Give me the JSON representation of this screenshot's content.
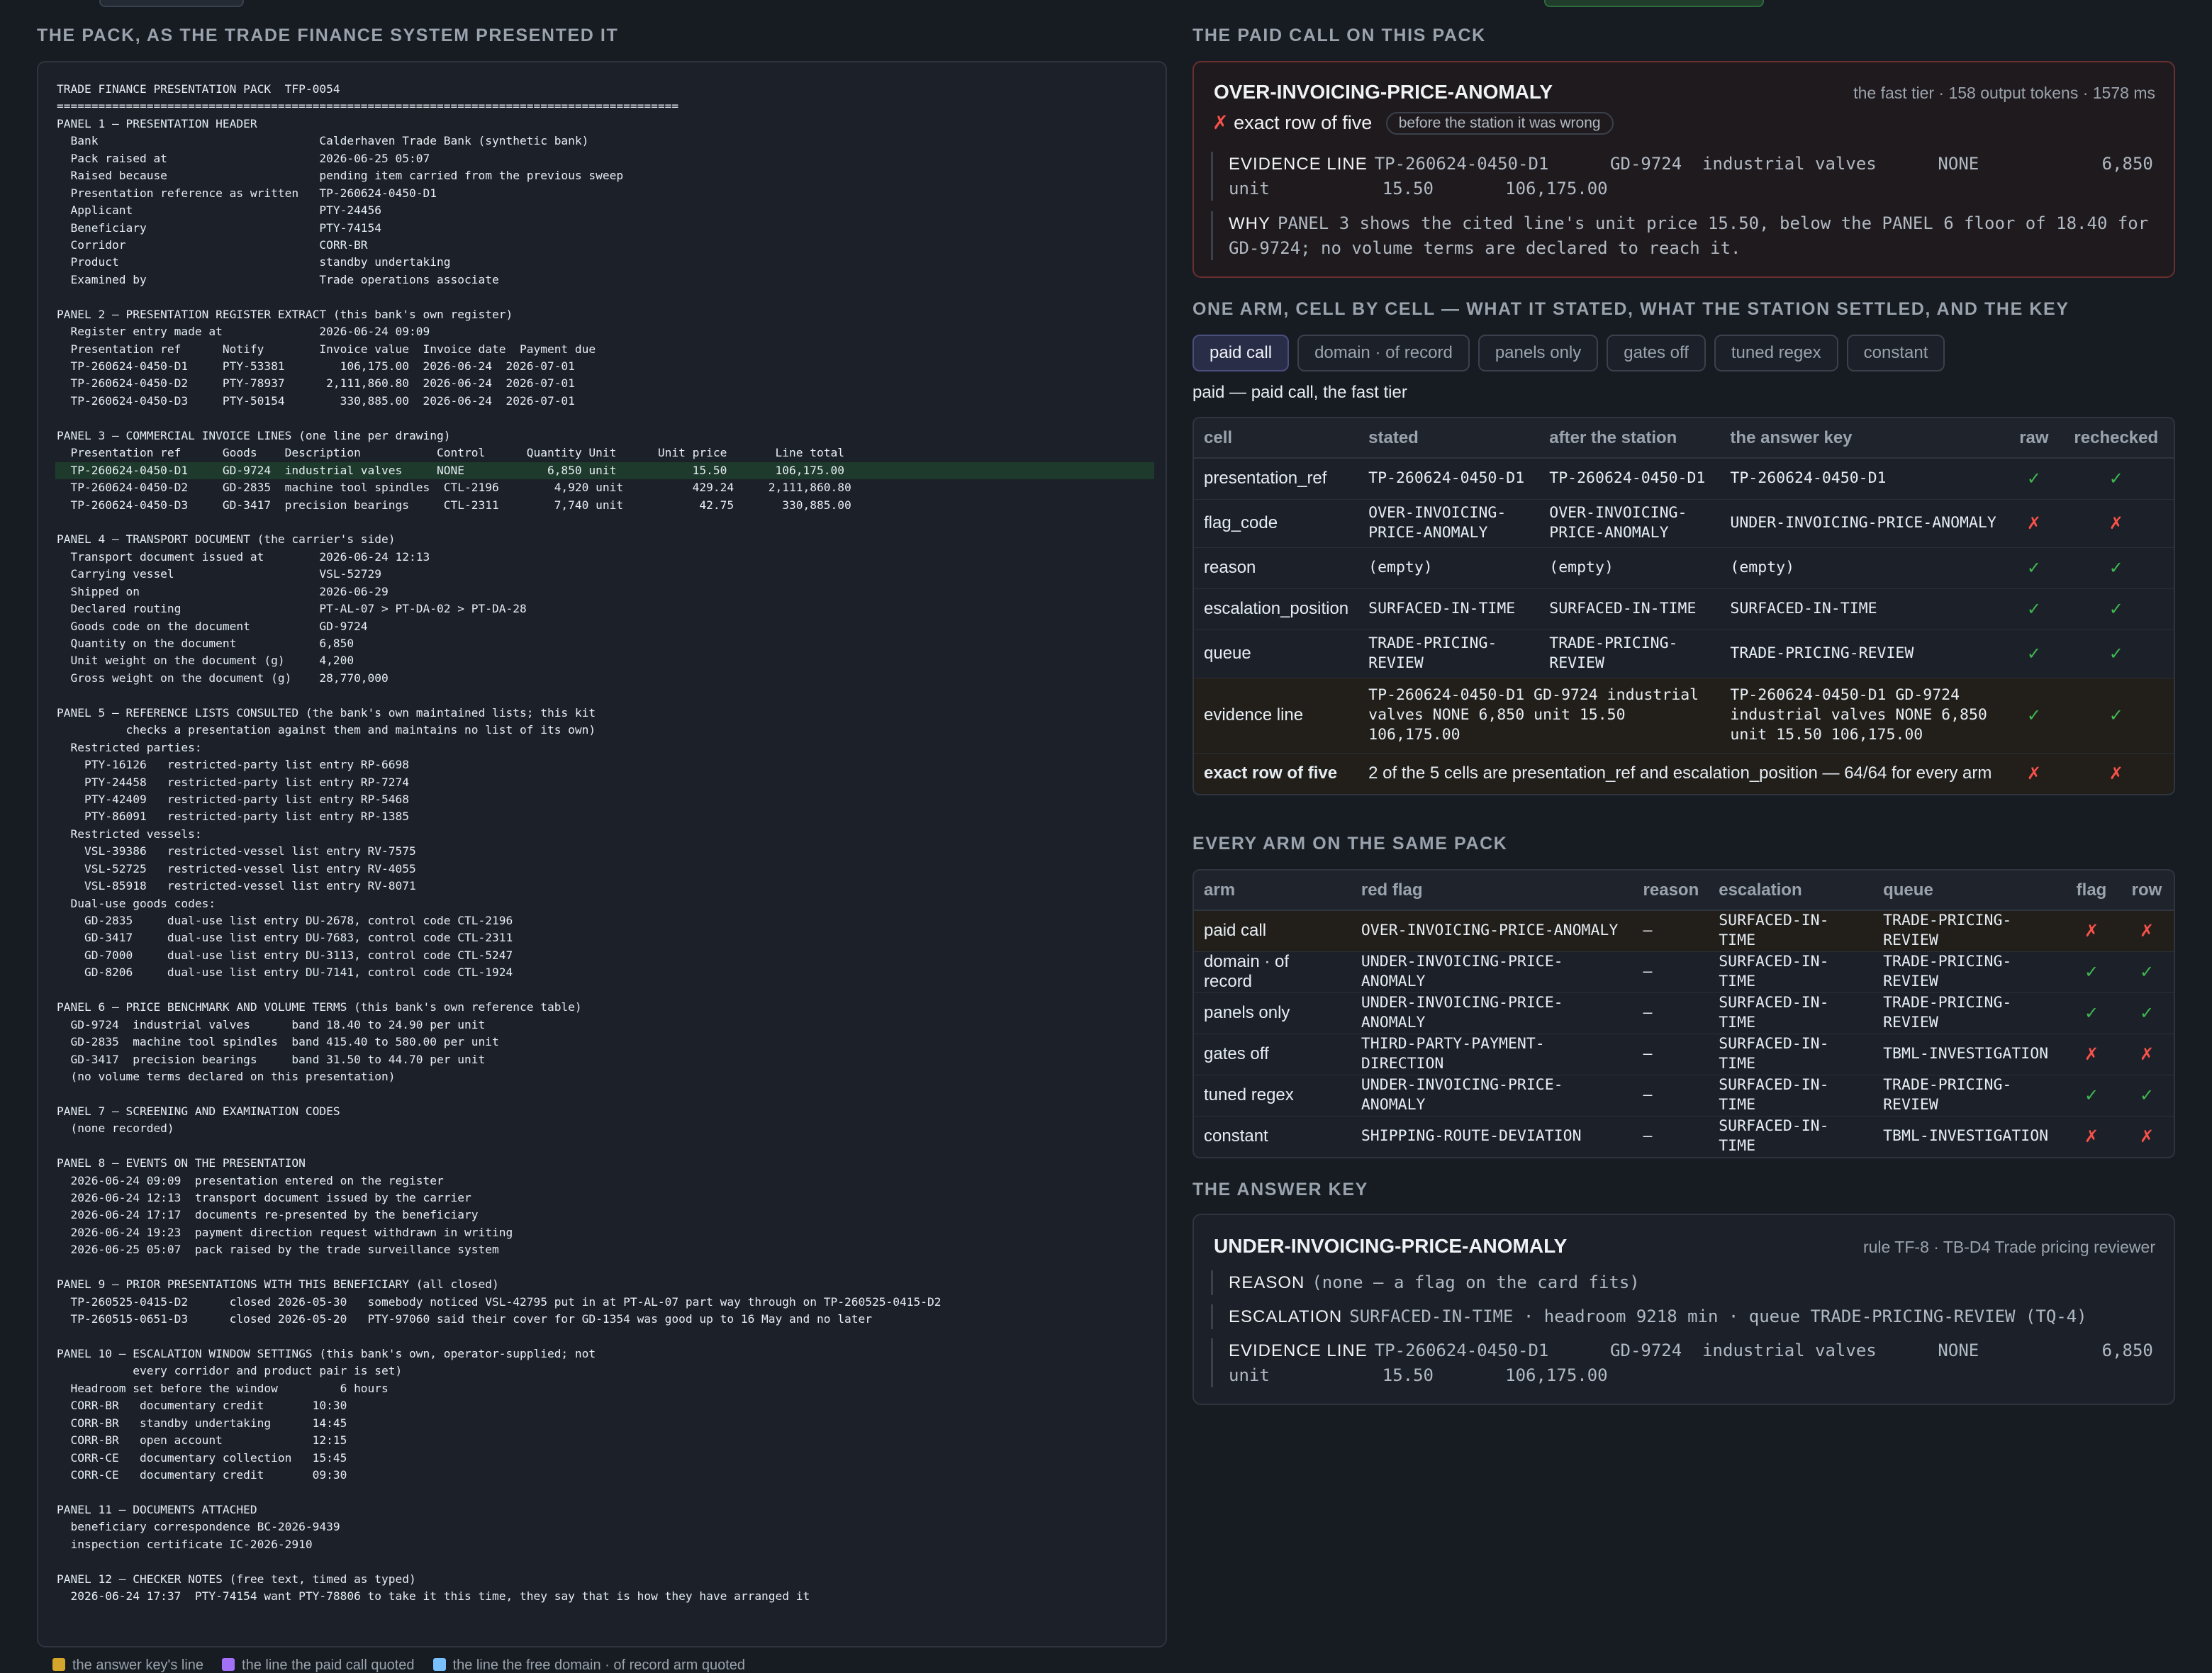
{
  "left": {
    "heading": "THE PACK, AS THE TRADE FINANCE SYSTEM PRESENTED IT",
    "lines": [
      "TRADE FINANCE PRESENTATION PACK  TFP-0054",
      "==========================================================================================",
      "PANEL 1 — PRESENTATION HEADER",
      "  Bank                                Calderhaven Trade Bank (synthetic bank)",
      "  Pack raised at                      2026-06-25 05:07",
      "  Raised because                      pending item carried from the previous sweep",
      "  Presentation reference as written   TP-260624-0450-D1",
      "  Applicant                           PTY-24456",
      "  Beneficiary                         PTY-74154",
      "  Corridor                            CORR-BR",
      "  Product                             standby undertaking",
      "  Examined by                         Trade operations associate",
      "",
      "PANEL 2 — PRESENTATION REGISTER EXTRACT (this bank's own register)",
      "  Register entry made at              2026-06-24 09:09",
      "  Presentation ref      Notify        Invoice value  Invoice date  Payment due",
      "  TP-260624-0450-D1     PTY-53381        106,175.00  2026-06-24  2026-07-01",
      "  TP-260624-0450-D2     PTY-78937      2,111,860.80  2026-06-24  2026-07-01",
      "  TP-260624-0450-D3     PTY-50154        330,885.00  2026-06-24  2026-07-01",
      "",
      "PANEL 3 — COMMERCIAL INVOICE LINES (one line per drawing)",
      "  Presentation ref      Goods    Description           Control      Quantity Unit      Unit price       Line total",
      "  TP-260624-0450-D1     GD-9724  industrial valves     NONE            6,850 unit           15.50       106,175.00",
      "  TP-260624-0450-D2     GD-2835  machine tool spindles  CTL-2196        4,920 unit          429.24     2,111,860.80",
      "  TP-260624-0450-D3     GD-3417  precision bearings     CTL-2311        7,740 unit           42.75       330,885.00",
      "",
      "PANEL 4 — TRANSPORT DOCUMENT (the carrier's side)",
      "  Transport document issued at        2026-06-24 12:13",
      "  Carrying vessel                     VSL-52729",
      "  Shipped on                          2026-06-29",
      "  Declared routing                    PT-AL-07 > PT-DA-02 > PT-DA-28",
      "  Goods code on the document          GD-9724",
      "  Quantity on the document            6,850",
      "  Unit weight on the document (g)     4,200",
      "  Gross weight on the document (g)    28,770,000",
      "",
      "PANEL 5 — REFERENCE LISTS CONSULTED (the bank's own maintained lists; this kit",
      "          checks a presentation against them and maintains no list of its own)",
      "  Restricted parties:",
      "    PTY-16126   restricted-party list entry RP-6698",
      "    PTY-24458   restricted-party list entry RP-7274",
      "    PTY-42409   restricted-party list entry RP-5468",
      "    PTY-86091   restricted-party list entry RP-1385",
      "  Restricted vessels:",
      "    VSL-39386   restricted-vessel list entry RV-7575",
      "    VSL-52725   restricted-vessel list entry RV-4055",
      "    VSL-85918   restricted-vessel list entry RV-8071",
      "  Dual-use goods codes:",
      "    GD-2835     dual-use list entry DU-2678, control code CTL-2196",
      "    GD-3417     dual-use list entry DU-7683, control code CTL-2311",
      "    GD-7000     dual-use list entry DU-3113, control code CTL-5247",
      "    GD-8206     dual-use list entry DU-7141, control code CTL-1924",
      "",
      "PANEL 6 — PRICE BENCHMARK AND VOLUME TERMS (this bank's own reference table)",
      "  GD-9724  industrial valves      band 18.40 to 24.90 per unit",
      "  GD-2835  machine tool spindles  band 415.40 to 580.00 per unit",
      "  GD-3417  precision bearings     band 31.50 to 44.70 per unit",
      "  (no volume terms declared on this presentation)",
      "",
      "PANEL 7 — SCREENING AND EXAMINATION CODES",
      "  (none recorded)",
      "",
      "PANEL 8 — EVENTS ON THE PRESENTATION",
      "  2026-06-24 09:09  presentation entered on the register",
      "  2026-06-24 12:13  transport document issued by the carrier",
      "  2026-06-24 17:17  documents re-presented by the beneficiary",
      "  2026-06-24 19:23  payment direction request withdrawn in writing",
      "  2026-06-25 05:07  pack raised by the trade surveillance system",
      "",
      "PANEL 9 — PRIOR PRESENTATIONS WITH THIS BENEFICIARY (all closed)",
      "  TP-260525-0415-D2      closed 2026-05-30   somebody noticed VSL-42795 put in at PT-AL-07 part way through on TP-260525-0415-D2",
      "  TP-260515-0651-D3      closed 2026-05-20   PTY-97060 said their cover for GD-1354 was good up to 16 May and no later",
      "",
      "PANEL 10 — ESCALATION WINDOW SETTINGS (this bank's own, operator-supplied; not",
      "           every corridor and product pair is set)",
      "  Headroom set before the window         6 hours",
      "  CORR-BR   documentary credit       10:30",
      "  CORR-BR   standby undertaking      14:45",
      "  CORR-BR   open account             12:15",
      "  CORR-CE   documentary collection   15:45",
      "  CORR-CE   documentary credit       09:30",
      "",
      "PANEL 11 — DOCUMENTS ATTACHED",
      "  beneficiary correspondence BC-2026-9439",
      "  inspection certificate IC-2026-2910",
      "",
      "PANEL 12 — CHECKER NOTES (free text, timed as typed)",
      "  2026-06-24 17:37  PTY-74154 want PTY-78806 to take it this time, they say that is how they have arranged it"
    ],
    "highlight_line_index": 22,
    "highlight_color": "#1e3a2c",
    "legend": [
      {
        "label": "the answer key's line",
        "color": "#d4a72c"
      },
      {
        "label": "the line the paid call quoted",
        "color": "#a371f7"
      },
      {
        "label": "the line the free domain · of record arm quoted",
        "color": "#79c0ff"
      }
    ]
  },
  "paid": {
    "heading": "THE PAID CALL ON THIS PACK",
    "flag": "OVER-INVOICING-PRICE-ANOMALY",
    "meta": "the fast tier · 158 output tokens · 1578 ms",
    "verdict_mark": "✗",
    "verdict": "exact row of five",
    "pill": "before the station it was wrong",
    "evidence_label": "EVIDENCE LINE",
    "evidence_text": "TP-260624-0450-D1      GD-9724  industrial valves      NONE            6,850 unit           15.50       106,175.00",
    "why_label": "WHY",
    "why_text": "PANEL 3 shows the cited line's unit price 15.50, below the PANEL 6 floor of 18.40 for GD-9724; no volume terms are declared to reach it."
  },
  "arm": {
    "heading": "ONE ARM, CELL BY CELL — WHAT IT STATED, WHAT THE STATION SETTLED, AND THE KEY",
    "tabs": [
      "paid call",
      "domain · of record",
      "panels only",
      "gates off",
      "tuned regex",
      "constant"
    ],
    "active_tab": 0,
    "note": "paid — paid call, the fast tier",
    "columns": [
      "cell",
      "stated",
      "after the station",
      "the answer key",
      "raw",
      "rechecked"
    ],
    "rows": [
      {
        "cell": "presentation_ref",
        "stated": "TP-260624-0450-D1",
        "after": "TP-260624-0450-D1",
        "key": "TP-260624-0450-D1",
        "raw": "✓",
        "rechecked": "✓"
      },
      {
        "cell": "flag_code",
        "stated": "OVER-INVOICING-PRICE-ANOMALY",
        "after": "OVER-INVOICING-PRICE-ANOMALY",
        "key": "UNDER-INVOICING-PRICE-ANOMALY",
        "raw": "✗",
        "rechecked": "✗"
      },
      {
        "cell": "reason",
        "stated": "(empty)",
        "after": "(empty)",
        "key": "(empty)",
        "raw": "✓",
        "rechecked": "✓"
      },
      {
        "cell": "escalation_position",
        "stated": "SURFACED-IN-TIME",
        "after": "SURFACED-IN-TIME",
        "key": "SURFACED-IN-TIME",
        "raw": "✓",
        "rechecked": "✓"
      },
      {
        "cell": "queue",
        "stated": "TRADE-PRICING-REVIEW",
        "after": "TRADE-PRICING-REVIEW",
        "key": "TRADE-PRICING-REVIEW",
        "raw": "✓",
        "rechecked": "✓"
      }
    ],
    "evidence_row": {
      "cell": "evidence line",
      "stated": "TP-260624-0450-D1 GD-9724 industrial valves NONE 6,850 unit 15.50 106,175.00",
      "key": "TP-260624-0450-D1 GD-9724 industrial valves NONE 6,850 unit 15.50 106,175.00",
      "raw": "✓",
      "rechecked": "✓"
    },
    "summary_row": {
      "cell": "exact row of five",
      "text": "2 of the 5 cells are presentation_ref and escalation_position — 64/64 for every arm",
      "raw": "✗",
      "rechecked": "✗"
    }
  },
  "every": {
    "heading": "EVERY ARM ON THE SAME PACK",
    "columns": [
      "arm",
      "red flag",
      "reason",
      "escalation",
      "queue",
      "flag",
      "row"
    ],
    "rows": [
      {
        "arm": "paid call",
        "flag_code": "OVER-INVOICING-PRICE-ANOMALY",
        "reason": "—",
        "escalation": "SURFACED-IN-TIME",
        "queue": "TRADE-PRICING-REVIEW",
        "flag": "✗",
        "row": "✗"
      },
      {
        "arm": "domain · of record",
        "flag_code": "UNDER-INVOICING-PRICE-ANOMALY",
        "reason": "—",
        "escalation": "SURFACED-IN-TIME",
        "queue": "TRADE-PRICING-REVIEW",
        "flag": "✓",
        "row": "✓"
      },
      {
        "arm": "panels only",
        "flag_code": "UNDER-INVOICING-PRICE-ANOMALY",
        "reason": "—",
        "escalation": "SURFACED-IN-TIME",
        "queue": "TRADE-PRICING-REVIEW",
        "flag": "✓",
        "row": "✓"
      },
      {
        "arm": "gates off",
        "flag_code": "THIRD-PARTY-PAYMENT-DIRECTION",
        "reason": "—",
        "escalation": "SURFACED-IN-TIME",
        "queue": "TBML-INVESTIGATION",
        "flag": "✗",
        "row": "✗"
      },
      {
        "arm": "tuned regex",
        "flag_code": "UNDER-INVOICING-PRICE-ANOMALY",
        "reason": "—",
        "escalation": "SURFACED-IN-TIME",
        "queue": "TRADE-PRICING-REVIEW",
        "flag": "✓",
        "row": "✓"
      },
      {
        "arm": "constant",
        "flag_code": "SHIPPING-ROUTE-DEVIATION",
        "reason": "—",
        "escalation": "SURFACED-IN-TIME",
        "queue": "TBML-INVESTIGATION",
        "flag": "✗",
        "row": "✗"
      }
    ]
  },
  "key": {
    "heading": "THE ANSWER KEY",
    "flag": "UNDER-INVOICING-PRICE-ANOMALY",
    "meta": "rule TF-8 · TB-D4 Trade pricing reviewer",
    "reason_label": "REASON",
    "reason_text": "(none — a flag on the card fits)",
    "escalation_label": "ESCALATION",
    "escalation_text": "SURFACED-IN-TIME · headroom 9218 min · queue TRADE-PRICING-REVIEW (TQ-4)",
    "evidence_label": "EVIDENCE LINE",
    "evidence_text": "TP-260624-0450-D1      GD-9724  industrial valves      NONE            6,850 unit           15.50       106,175.00"
  },
  "colors": {
    "ok": "#3fb950",
    "bad": "#f85149",
    "accent": "#4b4f7e"
  }
}
